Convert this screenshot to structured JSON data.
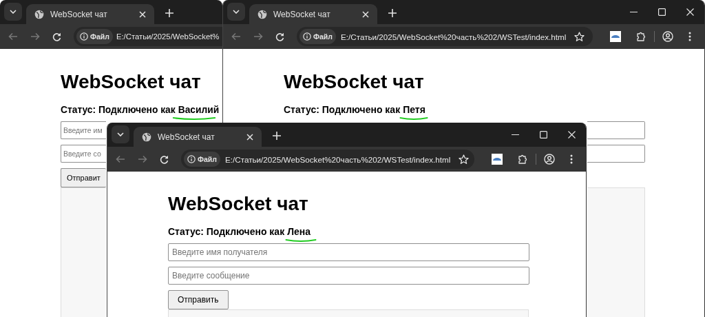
{
  "windows": [
    {
      "tab_title": "WebSocket чат",
      "scheme_label": "Файл",
      "url": "E:/Статьи/2025/WebSocket%",
      "window_controls": false,
      "toolbar_actions": false,
      "heading": "WebSocket чат",
      "status": "Статус: Подключено как",
      "user": "Василий",
      "recipient_placeholder": "Введите им",
      "message_placeholder": "Введите со",
      "send_button": "Отправит"
    },
    {
      "tab_title": "WebSocket чат",
      "scheme_label": "Файл",
      "url": "E:/Статьи/2025/WebSocket%20часть%202/WSTest/index.html",
      "window_controls": true,
      "toolbar_actions": true,
      "heading": "WebSocket чат",
      "status": "Статус: Подключено как",
      "user": "Петя"
    },
    {
      "tab_title": "WebSocket чат",
      "scheme_label": "Файл",
      "url": "E:/Статьи/2025/WebSocket%20часть%202/WSTest/index.html",
      "window_controls": true,
      "toolbar_actions": true,
      "heading": "WebSocket чат",
      "status": "Статус: Подключено как",
      "user": "Лена",
      "recipient_placeholder": "Введите имя получателя",
      "message_placeholder": "Введите сообщение",
      "send_button": "Отправить"
    }
  ]
}
